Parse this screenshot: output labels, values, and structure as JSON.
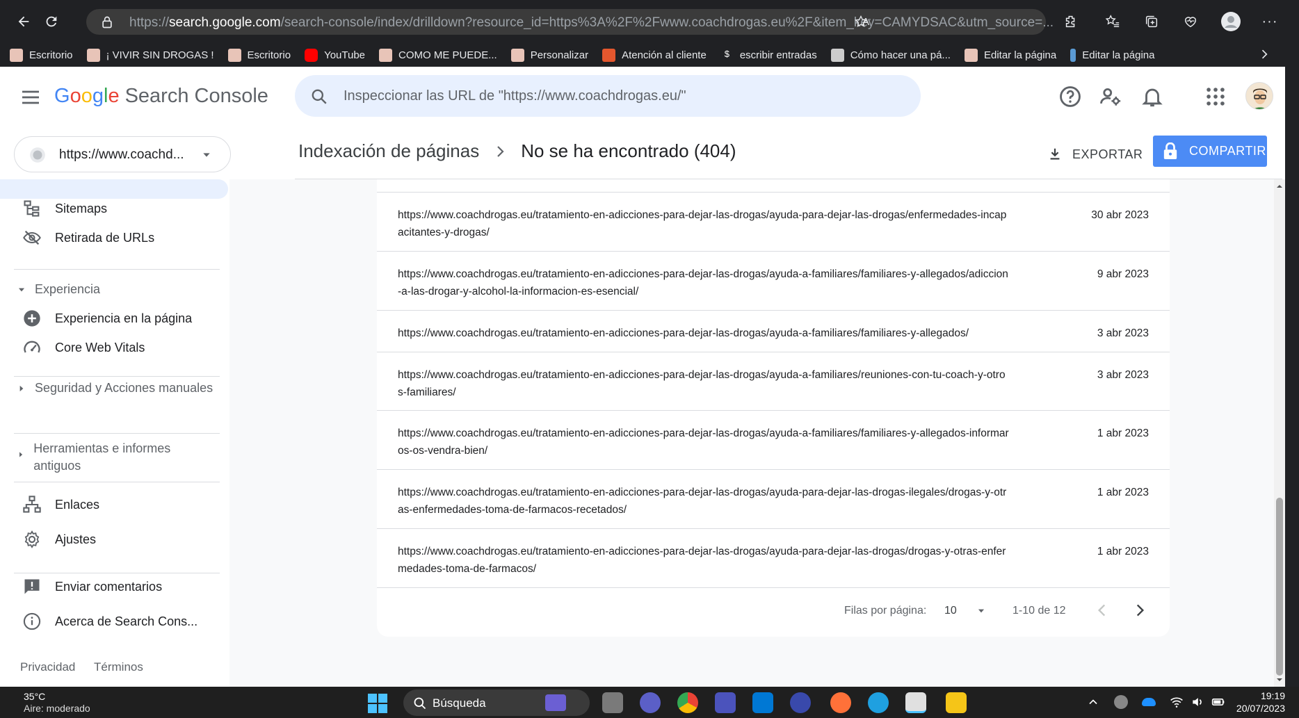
{
  "browser": {
    "url_prefix": "https://",
    "url_host": "search.google.com",
    "url_rest": "/search-console/index/drilldown?resource_id=https%3A%2F%2Fwww.coachdrogas.eu%2F&item_key=CAMYDSAC&utm_source=...",
    "bookmarks": [
      {
        "label": "Escritorio",
        "color": "#e8c4b8"
      },
      {
        "label": "¡ VIVIR SIN DROGAS !",
        "color": "#e8c4b8"
      },
      {
        "label": "Escritorio",
        "color": "#e8c4b8"
      },
      {
        "label": "YouTube",
        "color": "#ff0000"
      },
      {
        "label": "COMO ME PUEDE...",
        "color": "#e8c4b8"
      },
      {
        "label": "Personalizar",
        "color": "#e8c4b8"
      },
      {
        "label": "Atención al cliente",
        "color": "#e4572e"
      },
      {
        "label": "escribir entradas",
        "color": "#202124"
      },
      {
        "label": "Cómo hacer una pá...",
        "color": "#cccccc"
      },
      {
        "label": "Editar la página",
        "color": "#e8c4b8"
      },
      {
        "label": "Editar la página",
        "color": "#5b9bd5"
      }
    ]
  },
  "header": {
    "logo_letters": [
      "G",
      "o",
      "o",
      "g",
      "l",
      "e"
    ],
    "product_name": "Search Console",
    "search_placeholder": "Inspeccionar las URL de \"https://www.coachdrogas.eu/\""
  },
  "sidebar": {
    "property": "https://www.coachd...",
    "items": [
      {
        "label": "Sitemaps",
        "icon": "sitemap-icon"
      },
      {
        "label": "Retirada de URLs",
        "icon": "eye-off-icon"
      }
    ],
    "section_experiencia": "Experiencia",
    "experiencia_items": [
      {
        "label": "Experiencia en la página",
        "icon": "plus-circle-icon"
      },
      {
        "label": "Core Web Vitals",
        "icon": "gauge-icon"
      }
    ],
    "section_seguridad": "Seguridad y Acciones manuales",
    "section_herramientas": "Herramientas e informes antiguos",
    "bottom_items": [
      {
        "label": "Enlaces",
        "icon": "links-icon"
      },
      {
        "label": "Ajustes",
        "icon": "settings-icon"
      }
    ],
    "feedback": "Enviar comentarios",
    "about": "Acerca de Search Cons...",
    "footer_privacy": "Privacidad",
    "footer_terms": "Términos"
  },
  "page": {
    "breadcrumb_parent": "Indexación de páginas",
    "breadcrumb_current": "No se ha encontrado (404)",
    "export_label": "EXPORTAR",
    "share_label": "COMPARTIR"
  },
  "table": {
    "rows": [
      {
        "url": "https://www.coachdrogas.eu/tratamiento-en-adicciones-para-dejar-las-drogas/ayuda-para-dejar-las-drogas/enfermedades-incapacitantes-y-drogas/",
        "date": "30 abr 2023"
      },
      {
        "url": "https://www.coachdrogas.eu/tratamiento-en-adicciones-para-dejar-las-drogas/ayuda-a-familiares/familiares-y-allegados/adiccion-a-las-drogar-y-alcohol-la-informacion-es-esencial/",
        "date": "9 abr 2023"
      },
      {
        "url": "https://www.coachdrogas.eu/tratamiento-en-adicciones-para-dejar-las-drogas/ayuda-a-familiares/familiares-y-allegados/",
        "date": "3 abr 2023"
      },
      {
        "url": "https://www.coachdrogas.eu/tratamiento-en-adicciones-para-dejar-las-drogas/ayuda-a-familiares/reuniones-con-tu-coach-y-otros-familiares/",
        "date": "3 abr 2023"
      },
      {
        "url": "https://www.coachdrogas.eu/tratamiento-en-adicciones-para-dejar-las-drogas/ayuda-a-familiares/familiares-y-allegados-informaros-os-vendra-bien/",
        "date": "1 abr 2023"
      },
      {
        "url": "https://www.coachdrogas.eu/tratamiento-en-adicciones-para-dejar-las-drogas/ayuda-para-dejar-las-drogas-ilegales/drogas-y-otras-enfermedades-toma-de-farmacos-recetados/",
        "date": "1 abr 2023"
      },
      {
        "url": "https://www.coachdrogas.eu/tratamiento-en-adicciones-para-dejar-las-drogas/ayuda-para-dejar-las-drogas/drogas-y-otras-enfermedades-toma-de-farmacos/",
        "date": "1 abr 2023"
      }
    ],
    "rows_per_page_label": "Filas por página:",
    "rows_per_page_value": "10",
    "range": "1-10 de 12"
  },
  "taskbar": {
    "temperature": "35°C",
    "air": "Aire: moderado",
    "search_label": "Búsqueda",
    "time": "19:19",
    "date": "20/07/2023"
  },
  "colors": {
    "accent": "#4c8bf5",
    "active_nav": "#e8f0fe",
    "browser_chrome": "#202124"
  }
}
